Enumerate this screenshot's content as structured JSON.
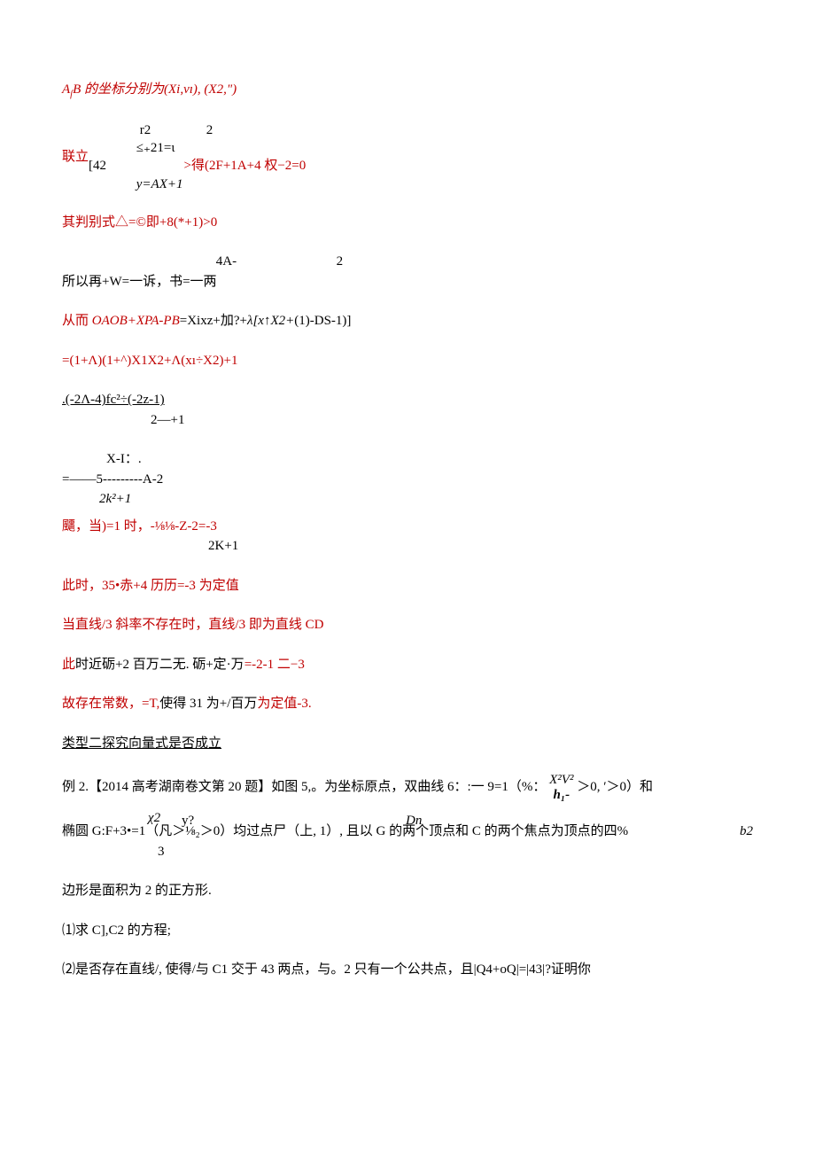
{
  "p1": {
    "pre": "A",
    "sub": "ſ",
    "mid": "B 的坐标分别为(Xi,vı), ",
    "paren": "(X2,\")"
  },
  "p2": {
    "lianli": "联立",
    "brace": "[",
    "top1": "r2",
    "top2": "2",
    "midrow": "≤₊21=ι",
    "row42": "42",
    "bottom": "y=AX+1",
    "result": ">得(2F+1A+4 权−2=0"
  },
  "p3": "其判别式△=©即+8(*+1)>0",
  "p4": {
    "prefix": "所以再+W=一诉，书=一两",
    "over1": "4A-",
    "over2": "2"
  },
  "p5": {
    "pre": "从而 ",
    "ital": "OAOB+XPA-PB",
    "mid": "=Xixz+加?+",
    "ital2": "λ[x↑X2+",
    "post": "(1)-DS-1)]"
  },
  "p6": "=(1+Λ)(1+^)X1X2+Λ(xı÷X2)+1",
  "p7": {
    "top": ".(-2Λ-4)fc²÷(-2z-1)",
    "bottom": "2—+1"
  },
  "p8": {
    "row1a": "X-I：.",
    "eq": "=——5---------A-2",
    "denom": "2k²+1"
  },
  "p9": {
    "pre": "飅，当)=1 时，-⅛⅛-Z-2",
    "eq": "=-3",
    "denom": "2K+1"
  },
  "p10": {
    "pre": "此时，35•赤+4 历历",
    "mid": "=-3 ",
    "post": "为定值"
  },
  "p11": "当直线/3 斜率不存在时，直线/3 即为直线 CD",
  "p12": {
    "pre": "此",
    "mid1": "时近砺+2 百万二无. 砺+定·万",
    "red1": "=-2-1 二",
    "red2": "−3"
  },
  "p13": {
    "pre": "故存在常数，=T,",
    "mid": "使得 31 为+/百万",
    "post": "为定值-3."
  },
  "sectionTitle": "类型二探究向量式是否成立",
  "p14": {
    "pre": "例 2.【2014 高考湖南卷文第 20 题】如图 5,。为坐标原点，双曲线 6：:一 9=1（%：",
    "stack_num": "X²V²",
    "stack_den": "h₁-",
    "cond": "＞0, ′＞0）和"
  },
  "p15": {
    "pre": "椭圆 G:F+3•=1（凡＞⅛₂＞0）均过点尸（上, 1）, 且以 G 的两个顶点和 C 的两个焦点为顶点的四%",
    "stack_top": "χ2",
    "stack_y": "y?",
    "stack_bottom": "3",
    "Dn": "Dn",
    "b2": "b2"
  },
  "p16": "边形是面积为 2 的正方形.",
  "p17": "⑴求 C],C2 的方程;",
  "p18": "⑵是否存在直线/, 使得/与 C1 交于 43 两点，与。2 只有一个公共点，且|Q4+oQ|=|43|?证明你"
}
